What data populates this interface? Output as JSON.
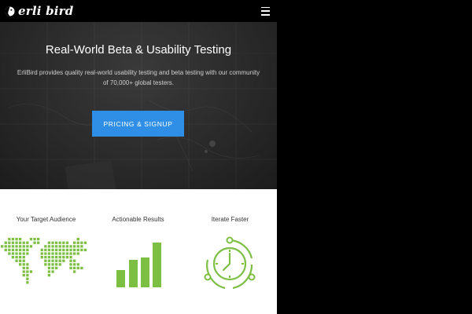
{
  "header": {
    "logo_text": "erli bird",
    "menu_icon": "hamburger-menu-icon"
  },
  "hero": {
    "title": "Real-World Beta & Usability Testing",
    "subtitle": "ErliBird provides quality real-world usability testing and beta testing with our community of 70,000+ global testers.",
    "cta_label": "PRICING & SIGNUP"
  },
  "features": [
    {
      "title": "Your Target Audience",
      "icon": "world-map-icon"
    },
    {
      "title": "Actionable Results",
      "icon": "bar-chart-icon"
    },
    {
      "title": "Iterate Faster",
      "icon": "cycle-clock-icon"
    }
  ],
  "colors": {
    "accent_blue": "#2f8fe6",
    "feature_green": "#7cbf42",
    "hero_background": "#2a2a2a",
    "header_background": "#000000"
  }
}
